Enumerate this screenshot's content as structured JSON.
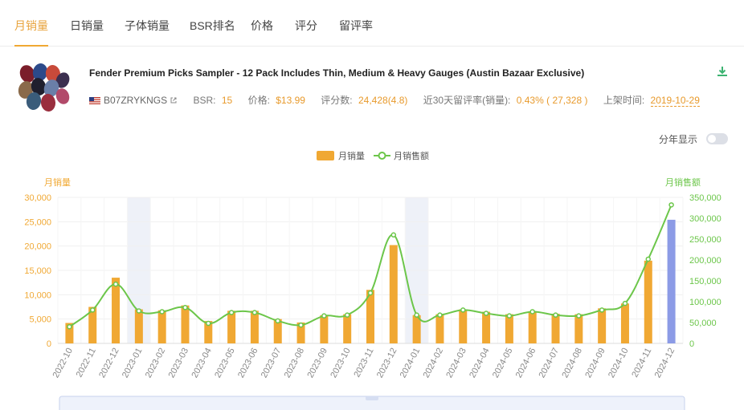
{
  "tabs": [
    {
      "label": "月销量",
      "active": true
    },
    {
      "label": "日销量",
      "active": false
    },
    {
      "label": "子体销量",
      "active": false
    },
    {
      "label": "BSR排名",
      "active": false
    },
    {
      "label": "价格",
      "active": false
    },
    {
      "label": "评分",
      "active": false
    },
    {
      "label": "留评率",
      "active": false
    }
  ],
  "product": {
    "title": "Fender Premium Picks Sampler - 12 Pack Includes Thin, Medium & Heavy Gauges (Austin Bazaar Exclusive)",
    "asin": "B07ZRYKNGS",
    "bsr_label": "BSR:",
    "bsr_value": "15",
    "price_label": "价格:",
    "price_value": "$13.99",
    "reviews_label": "评分数:",
    "reviews_value": "24,428(4.8)",
    "rate_label": "近30天留评率(销量):",
    "rate_value": "0.43% ( 27,328 )",
    "listed_label": "上架时间:",
    "listed_value": "2019-10-29"
  },
  "toggle": {
    "label": "分年显示",
    "on": false
  },
  "colors": {
    "accent": "#f0a833",
    "line": "#6cc64a",
    "highlight_bar": "#8c9be6",
    "band": "#eef1f8"
  },
  "chart_data": {
    "type": "bar",
    "legend": [
      "月销量",
      "月销售额"
    ],
    "legend_position": "top-center",
    "ylabel_left": "月销量",
    "ylabel_right": "月销售额",
    "ylim_left": [
      0,
      30000
    ],
    "ylim_right": [
      0,
      350000
    ],
    "yticks_left": [
      "0",
      "5,000",
      "10,000",
      "15,000",
      "20,000",
      "25,000",
      "30,000"
    ],
    "yticks_right": [
      "0",
      "50,000",
      "100,000",
      "150,000",
      "200,000",
      "250,000",
      "300,000",
      "350,000"
    ],
    "categories": [
      "2022-10",
      "2022-11",
      "2022-12",
      "2023-01",
      "2023-02",
      "2023-03",
      "2023-04",
      "2023-05",
      "2023-06",
      "2023-07",
      "2023-08",
      "2023-09",
      "2023-10",
      "2023-11",
      "2023-12",
      "2024-01",
      "2024-02",
      "2024-03",
      "2024-04",
      "2024-05",
      "2024-06",
      "2024-07",
      "2024-08",
      "2024-09",
      "2024-10",
      "2024-11",
      "2024-12"
    ],
    "shaded_categories": [
      "2023-01",
      "2024-01"
    ],
    "highlight_category": "2024-12",
    "series": [
      {
        "name": "月销量",
        "type": "bar",
        "axis": "left",
        "values": [
          4200,
          7500,
          13500,
          7000,
          6800,
          7800,
          4600,
          6700,
          6700,
          5000,
          4300,
          5800,
          6000,
          11000,
          20200,
          5800,
          6000,
          7000,
          6500,
          6000,
          6600,
          6100,
          6000,
          7200,
          8200,
          17000,
          25400
        ]
      },
      {
        "name": "月销售额",
        "type": "line",
        "axis": "right",
        "values": [
          40000,
          80000,
          142000,
          78000,
          76000,
          86000,
          48000,
          74000,
          74000,
          54000,
          44000,
          66000,
          68000,
          121000,
          260000,
          68000,
          68000,
          80000,
          72000,
          66000,
          76000,
          68000,
          66000,
          80000,
          96000,
          202000,
          332000
        ]
      }
    ]
  }
}
